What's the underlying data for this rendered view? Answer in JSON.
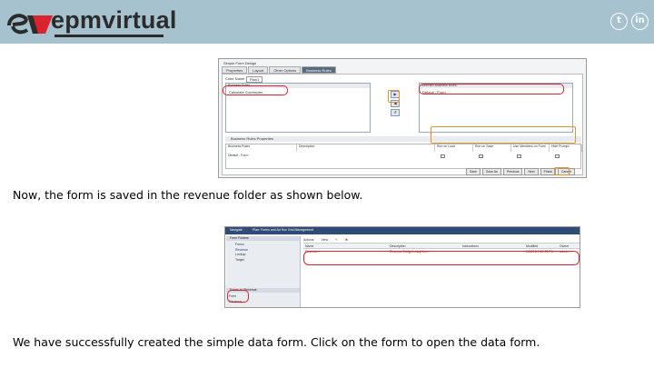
{
  "header": {
    "logo_text": "epmvirtual",
    "social": {
      "twitter_glyph": "t",
      "linkedin_glyph": "in"
    },
    "background_color": "#a7c2cf",
    "accent_color": "#d9232d"
  },
  "screenshot1": {
    "title": "Simple Form Design",
    "tabs": [
      "Properties",
      "Layout",
      "Other Options",
      "Business Rules"
    ],
    "active_tab": "Business Rules",
    "cube_label": "Cube Name",
    "cube_value": "Plan1",
    "rule_list_header": "Business Rules",
    "rule_list_item": "Calculate Currencies",
    "selected_list_header": "Selected Business Rules",
    "selected_list_item": "Default - Form",
    "arrow_buttons": [
      "Add",
      "Remove"
    ],
    "properties_section": "Business Rules Properties",
    "table_headers": [
      "Business Rules",
      "Description",
      "Run on Load",
      "Run on Save",
      "Use Members on Form",
      "Hide Prompt"
    ],
    "table_row": [
      "Default - Form"
    ],
    "footer_buttons": [
      "Save",
      "Save As",
      "Previous",
      "Next",
      "Finish",
      "Cancel"
    ]
  },
  "captions": {
    "first": "Now, the form is saved in the revenue folder as shown below.",
    "second": "We have successfully created the simple data form. Click on the form to open the data form."
  },
  "screenshot2": {
    "top_tabs": [
      "Navigate",
      "Plan: Forms and Ad Hoc Grid Management"
    ],
    "side_header": "Form Folders",
    "tree_items": [
      "Forms",
      "Revenue",
      "Lookup",
      "Target"
    ],
    "selected_tree_item": "Revenue",
    "side_header_2": "Forms in: Revenue",
    "side_items": [
      "Form",
      "Revenue"
    ],
    "toolbar_items": [
      "Actions",
      "View",
      "Edit",
      "Delete"
    ],
    "columns": [
      "Name",
      "Description",
      "Instructions",
      "Modified",
      "Owner"
    ],
    "row": [
      "Revenue",
      "Revenue budget entry form",
      "",
      "5/12/18 9:15:03 PM",
      "admin"
    ]
  }
}
